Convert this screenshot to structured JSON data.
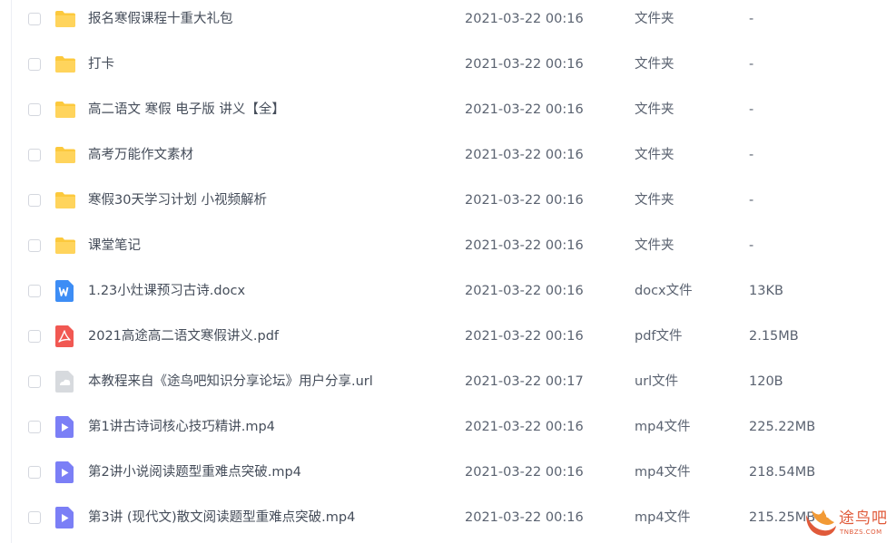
{
  "files": [
    {
      "name": "报名寒假课程十重大礼包",
      "date": "2021-03-22 00:16",
      "type": "文件夹",
      "size": "-",
      "icon": "folder-icon"
    },
    {
      "name": "打卡",
      "date": "2021-03-22 00:16",
      "type": "文件夹",
      "size": "-",
      "icon": "folder-icon"
    },
    {
      "name": "高二语文 寒假 电子版 讲义【全】",
      "date": "2021-03-22 00:16",
      "type": "文件夹",
      "size": "-",
      "icon": "folder-icon"
    },
    {
      "name": "高考万能作文素材",
      "date": "2021-03-22 00:16",
      "type": "文件夹",
      "size": "-",
      "icon": "folder-icon"
    },
    {
      "name": "寒假30天学习计划 小视频解析",
      "date": "2021-03-22 00:16",
      "type": "文件夹",
      "size": "-",
      "icon": "folder-icon"
    },
    {
      "name": "课堂笔记",
      "date": "2021-03-22 00:16",
      "type": "文件夹",
      "size": "-",
      "icon": "folder-icon"
    },
    {
      "name": "1.23小灶课预习古诗.docx",
      "date": "2021-03-22 00:16",
      "type": "docx文件",
      "size": "13KB",
      "icon": "word-file-icon"
    },
    {
      "name": "2021高途高二语文寒假讲义.pdf",
      "date": "2021-03-22 00:16",
      "type": "pdf文件",
      "size": "2.15MB",
      "icon": "pdf-file-icon"
    },
    {
      "name": "本教程来自《途鸟吧知识分享论坛》用户分享.url",
      "date": "2021-03-22 00:17",
      "type": "url文件",
      "size": "120B",
      "icon": "url-file-icon"
    },
    {
      "name": "第1讲古诗词核心技巧精讲.mp4",
      "date": "2021-03-22 00:16",
      "type": "mp4文件",
      "size": "225.22MB",
      "icon": "video-file-icon"
    },
    {
      "name": "第2讲小说阅读题型重难点突破.mp4",
      "date": "2021-03-22 00:16",
      "type": "mp4文件",
      "size": "218.54MB",
      "icon": "video-file-icon"
    },
    {
      "name": "第3讲 (现代文)散文阅读题型重难点突破.mp4",
      "date": "2021-03-22 00:16",
      "type": "mp4文件",
      "size": "215.25MB",
      "icon": "video-file-icon"
    }
  ],
  "watermark": {
    "title": "途鸟吧",
    "subtitle": "TNBZS.COM"
  },
  "colors": {
    "folder": "#fcc93d",
    "word": "#3d8df5",
    "pdf": "#f15852",
    "url": "#d7dade",
    "video": "#7b7ff6",
    "text": "#454d5a",
    "watermark": "#e05a3a"
  }
}
